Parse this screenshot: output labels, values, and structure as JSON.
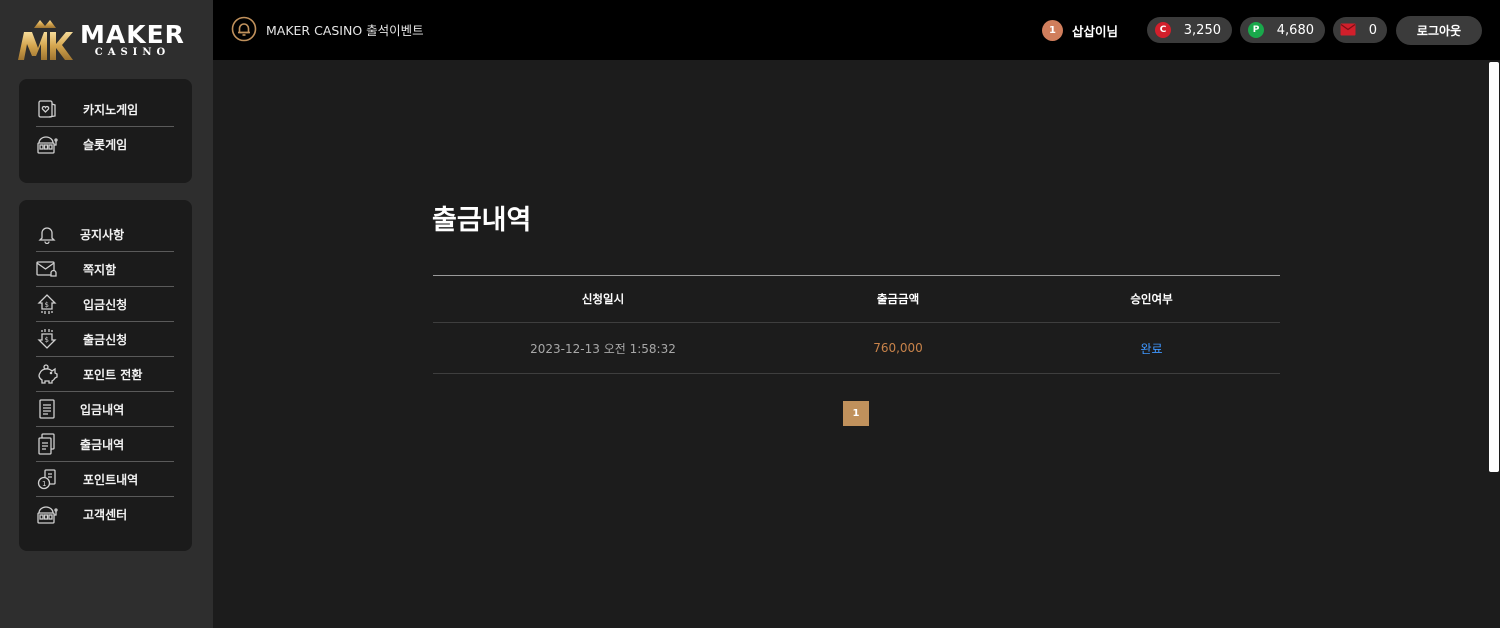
{
  "logo": {
    "main": "MAKER",
    "sub": "CASINO"
  },
  "sidebar": {
    "games": [
      {
        "label": "카지노게임",
        "icon": "card-heart-icon"
      },
      {
        "label": "슬롯게임",
        "icon": "slot-machine-icon"
      }
    ],
    "menu": [
      {
        "label": "공지사항",
        "icon": "bell-icon"
      },
      {
        "label": "쪽지함",
        "icon": "mail-icon"
      },
      {
        "label": "입금신청",
        "icon": "deposit-icon"
      },
      {
        "label": "출금신청",
        "icon": "withdraw-icon"
      },
      {
        "label": "포인트 전환",
        "icon": "piggy-bank-icon"
      },
      {
        "label": "입금내역",
        "icon": "deposit-history-icon"
      },
      {
        "label": "출금내역",
        "icon": "withdraw-history-icon"
      },
      {
        "label": "포인트내역",
        "icon": "point-history-icon"
      },
      {
        "label": "고객센터",
        "icon": "support-icon"
      }
    ]
  },
  "header": {
    "event_label": "MAKER CASINO 출석이벤트",
    "user": {
      "level": "1",
      "name": "삽삽이님"
    },
    "balances": {
      "cash_symbol": "C",
      "cash": "3,250",
      "point_symbol": "P",
      "point": "4,680",
      "messages": "0"
    },
    "logout_label": "로그아웃"
  },
  "main": {
    "title": "출금내역",
    "table": {
      "columns": [
        "신청일시",
        "출금금액",
        "승인여부"
      ],
      "rows": [
        {
          "date": "2023-12-13 오전 1:58:32",
          "amount": "760,000",
          "status": "완료"
        }
      ]
    },
    "pagination": {
      "current_page": "1"
    }
  },
  "colors": {
    "accent_gold": "#c0915c",
    "amount_orange": "#c8834a",
    "status_blue": "#3f97ff",
    "cash_red": "#d21f2b",
    "point_green": "#19a84b"
  }
}
